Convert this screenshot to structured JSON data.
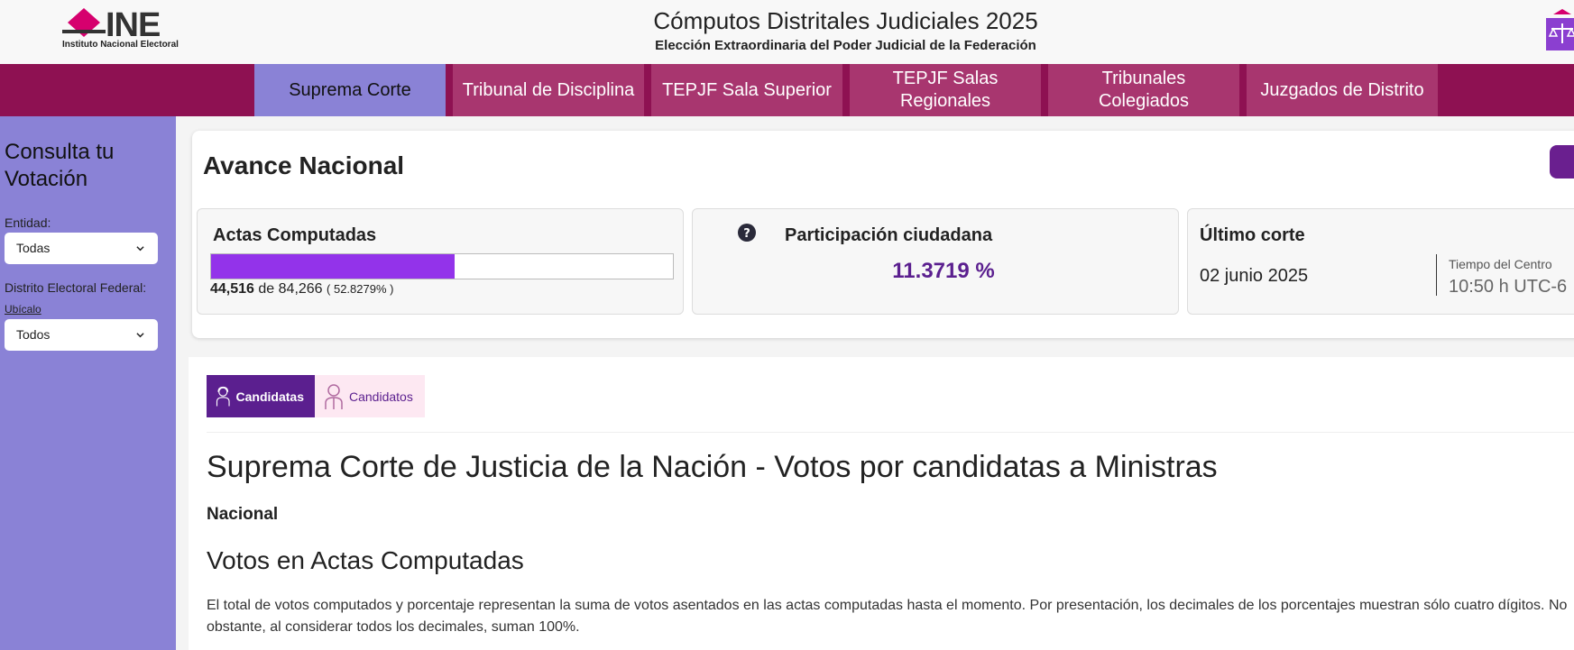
{
  "header": {
    "logo_text": "INE",
    "logo_subtitle": "Instituto Nacional Electoral",
    "title": "Cómputos Distritales Judiciales 2025",
    "subtitle": "Elección Extraordinaria del Poder Judicial de la Federación"
  },
  "nav": {
    "tabs": [
      {
        "label": "Suprema Corte",
        "active": true
      },
      {
        "label": "Tribunal de Disciplina",
        "active": false
      },
      {
        "label": "TEPJF Sala Superior",
        "active": false
      },
      {
        "label": "TEPJF Salas Regionales",
        "active": false
      },
      {
        "label": "Tribunales Colegiados",
        "active": false
      },
      {
        "label": "Juzgados de Distrito",
        "active": false
      }
    ]
  },
  "sidebar": {
    "title": "Consulta tu Votación",
    "entidad_label": "Entidad:",
    "entidad_value": "Todas",
    "distrito_label": "Distrito Electoral Federal:",
    "ubicalo_link": "Ubícalo",
    "distrito_value": "Todos"
  },
  "avance": {
    "title": "Avance Nacional",
    "actas": {
      "title": "Actas Computadas",
      "computed": "44,516",
      "of_text": "de",
      "total": "84,266",
      "percent_text": "( 52.8279% )",
      "progress": 0.528279
    },
    "participacion": {
      "title": "Participación ciudadana",
      "value": "11.3719 %"
    },
    "corte": {
      "title": "Último corte",
      "date": "02 junio 2025",
      "time_label": "Tiempo del Centro",
      "time": "10:50 h UTC-6"
    }
  },
  "content": {
    "tabs": {
      "candidatas": "Candidatas",
      "candidatos": "Candidatos"
    },
    "heading": "Suprema Corte de Justicia de la Nación - Votos por candidatas a Ministras",
    "scope": "Nacional",
    "section_title": "Votos en Actas Computadas",
    "paragraph": "El total de votos computados y porcentaje representan la suma de votos asentados en las actas computadas hasta el momento. Por presentación, los decimales de los porcentajes muestran sólo cuatro dígitos. No obstante, al considerar todos los decimales, suman 100%."
  },
  "colors": {
    "nav_bg": "#8e1152",
    "nav_tab": "#a8366f",
    "active_tab": "#8a82d6",
    "accent_purple": "#5b1f8f",
    "progress_fill": "#9333ea"
  }
}
